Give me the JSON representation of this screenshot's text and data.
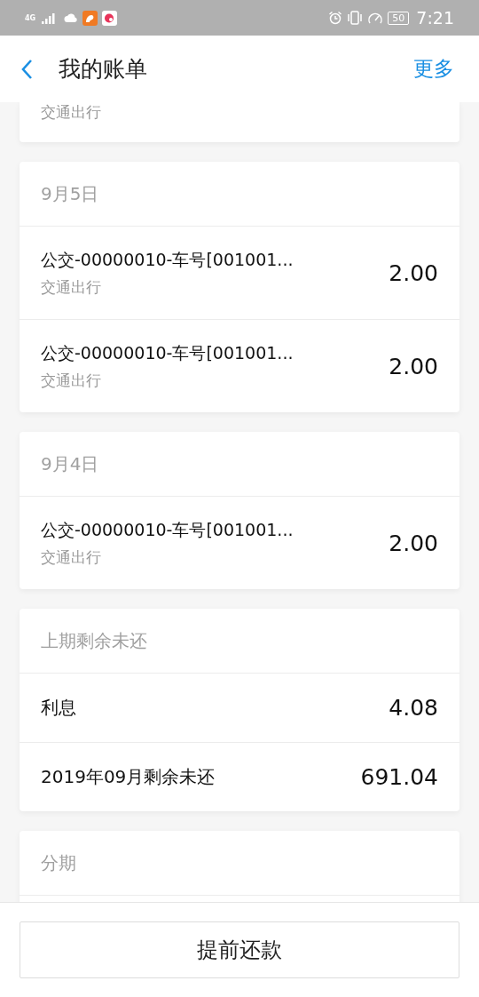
{
  "status_bar": {
    "network": "4G",
    "battery": "50",
    "time": "7:21"
  },
  "header": {
    "title": "我的账单",
    "action": "更多"
  },
  "sections": [
    {
      "kind": "tail",
      "items": [
        {
          "category": "交通出行"
        }
      ]
    },
    {
      "kind": "transactions",
      "title": "9月5日",
      "items": [
        {
          "title": "公交-00000010-车号[001001...",
          "category": "交通出行",
          "amount": "2.00"
        },
        {
          "title": "公交-00000010-车号[001001...",
          "category": "交通出行",
          "amount": "2.00"
        }
      ]
    },
    {
      "kind": "transactions",
      "title": "9月4日",
      "items": [
        {
          "title": "公交-00000010-车号[001001...",
          "category": "交通出行",
          "amount": "2.00"
        }
      ]
    },
    {
      "kind": "summary",
      "title": "上期剩余未还",
      "items": [
        {
          "label": "利息",
          "amount": "4.08"
        },
        {
          "label": "2019年09月剩余未还",
          "amount": "691.04"
        }
      ]
    },
    {
      "kind": "heading",
      "title": "分期"
    }
  ],
  "footer_button": "提前还款"
}
